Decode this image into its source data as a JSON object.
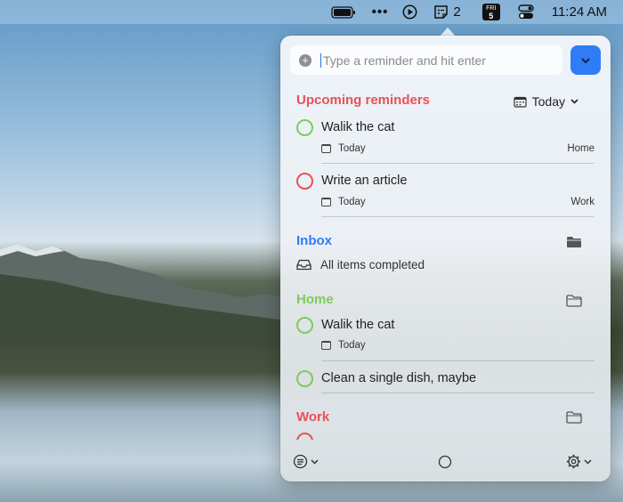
{
  "menubar": {
    "dots": "•••",
    "notes_count": "2",
    "calendar_day": "FRI",
    "calendar_date": "5",
    "clock": "11:24 AM"
  },
  "input": {
    "placeholder": "Type a reminder and hit enter"
  },
  "upcoming": {
    "title": "Upcoming reminders",
    "filter_label": "Today",
    "items": [
      {
        "title": "Walik the cat",
        "date": "Today",
        "tag": "Home",
        "color": "#7ecb5b"
      },
      {
        "title": "Write an article",
        "date": "Today",
        "tag": "Work",
        "color": "#e8505b"
      }
    ]
  },
  "inbox": {
    "title": "Inbox",
    "empty_text": "All items completed",
    "color": "#2f7cf6"
  },
  "home": {
    "title": "Home",
    "color": "#7ecb5b",
    "items": [
      {
        "title": "Walik the cat",
        "date": "Today"
      },
      {
        "title": "Clean a single dish, maybe"
      }
    ]
  },
  "work": {
    "title": "Work",
    "color": "#e8505b"
  },
  "colors": {
    "accent": "#2f7cf6",
    "upcoming_header": "#e8505b",
    "green": "#7ecb5b",
    "red": "#e8505b"
  }
}
